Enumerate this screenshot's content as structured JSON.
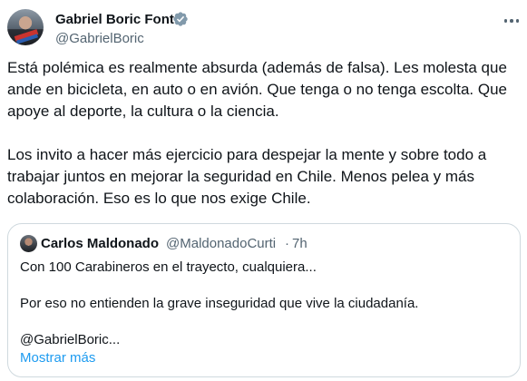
{
  "author": {
    "display_name": "Gabriel Boric Font",
    "handle": "@GabrielBoric",
    "verified_icon": "verified-badge-icon",
    "avatar_icon": "profile-photo"
  },
  "tweet": {
    "paragraph_1": "Está polémica es realmente absurda (además de falsa). Les molesta que ande en bicicleta, en auto o en avión. Que tenga o no tenga escolta. Que apoye al deporte, la cultura o la ciencia.",
    "paragraph_2": "Los invito a hacer más ejercicio para despejar la mente y sobre todo a trabajar juntos en mejorar la seguridad en Chile. Menos pelea y más colaboración. Eso es lo que nos exige Chile."
  },
  "quote": {
    "display_name": "Carlos Maldonado",
    "handle": "@MaldonadoCurti",
    "separator": "·",
    "time": "7h",
    "line_1": "Con 100 Carabineros en el trayecto, cualquiera...",
    "line_2": "Por eso no entienden la grave inseguridad que vive la ciudadanía.",
    "line_3": "@GabrielBoric...",
    "show_more": "Mostrar más"
  },
  "colors": {
    "text": "#0f1419",
    "secondary": "#536471",
    "link": "#1d9bf0",
    "verified": "#829aab",
    "border": "#cfd9de"
  }
}
